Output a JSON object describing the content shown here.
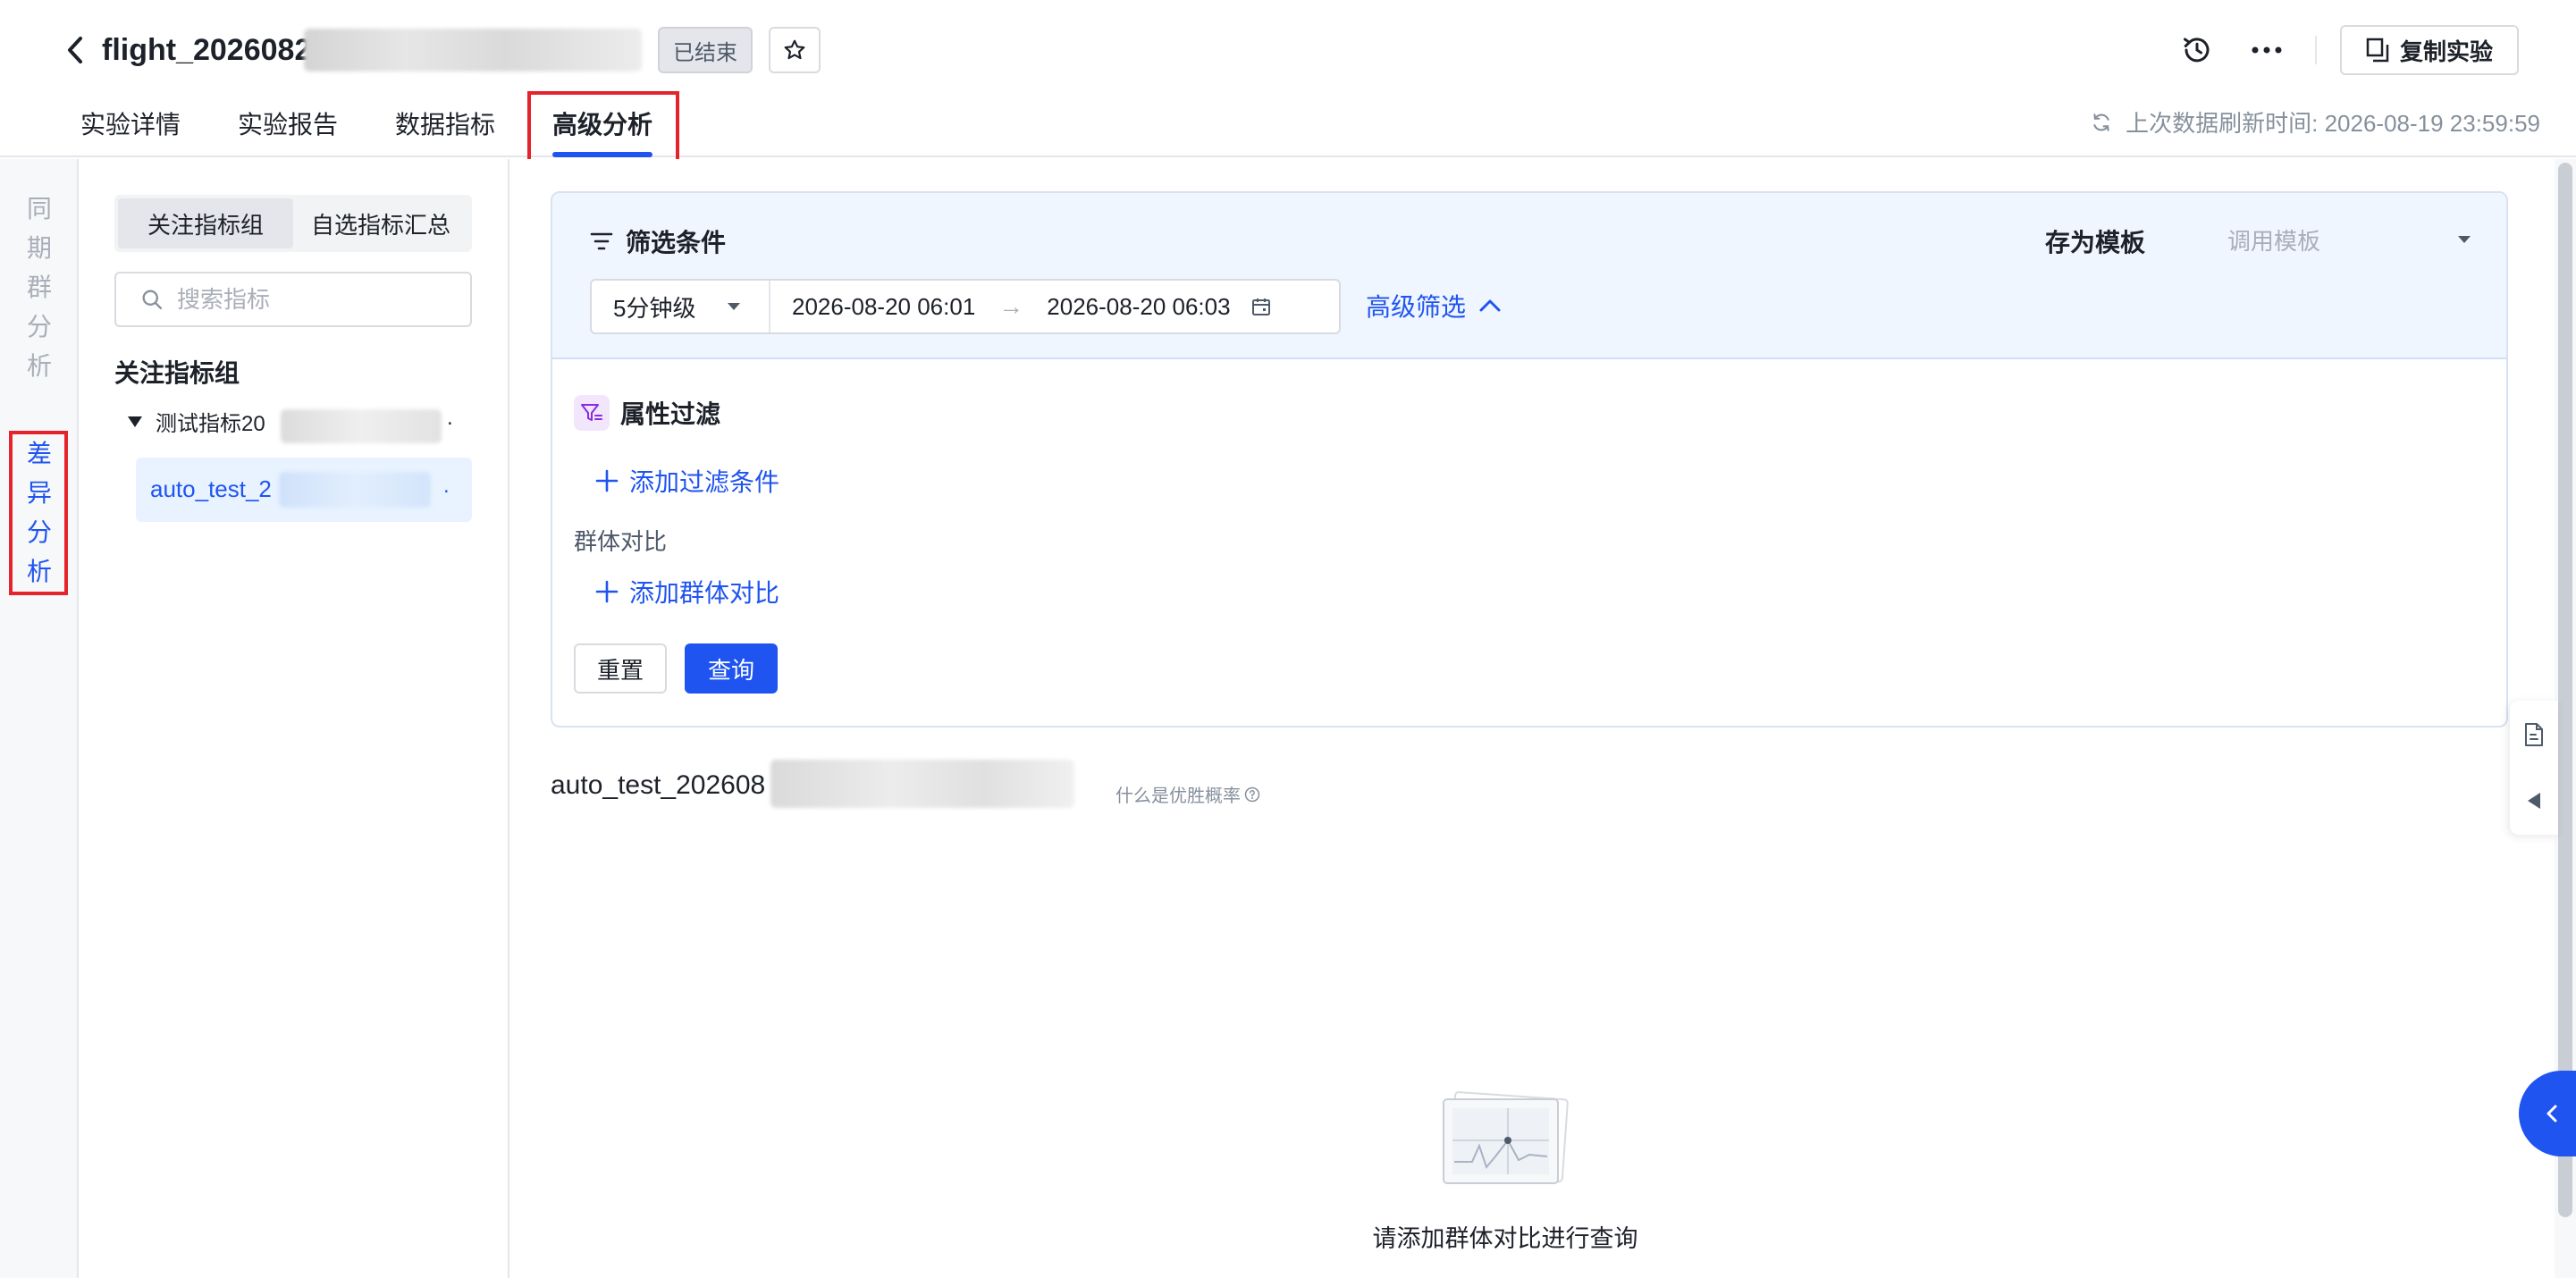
{
  "header": {
    "title": "flight_2026082",
    "status": "已结束",
    "copy_label": "复制实验",
    "refresh_text": "上次数据刷新时间: 2026-08-19 23:59:59"
  },
  "tabs": [
    {
      "label": "实验详情"
    },
    {
      "label": "实验报告"
    },
    {
      "label": "数据指标"
    },
    {
      "label": "高级分析"
    }
  ],
  "vnav": {
    "cohort": [
      "同",
      "期",
      "群",
      "分",
      "析"
    ],
    "diff": [
      "差",
      "异",
      "分",
      "析"
    ]
  },
  "metric_sidebar": {
    "seg": [
      "关注指标组",
      "自选指标汇总"
    ],
    "search_placeholder": "搜索指标",
    "group_title": "关注指标组",
    "tree_node": "测试指标20",
    "tree_node_ellipsis": ".",
    "leaf": "auto_test_2",
    "leaf_ellipsis": "."
  },
  "filter": {
    "title": "筛选条件",
    "save_template": "存为模板",
    "use_template": "调用模板",
    "granularity": "5分钟级",
    "start": "2026-08-20 06:01",
    "end": "2026-08-20 06:03",
    "advanced": "高级筛选",
    "attr_title": "属性过滤",
    "add_condition": "添加过滤条件",
    "group_label": "群体对比",
    "add_group": "添加群体对比",
    "reset": "重置",
    "query": "查询"
  },
  "result": {
    "metric_name": "auto_test_202608",
    "win_prob": "什么是优胜概率",
    "empty_text": "请添加群体对比进行查询"
  },
  "colors": {
    "primary": "#1f54f0",
    "highlight_box": "#e5232c",
    "filter_bg": "#f0f6ff"
  }
}
